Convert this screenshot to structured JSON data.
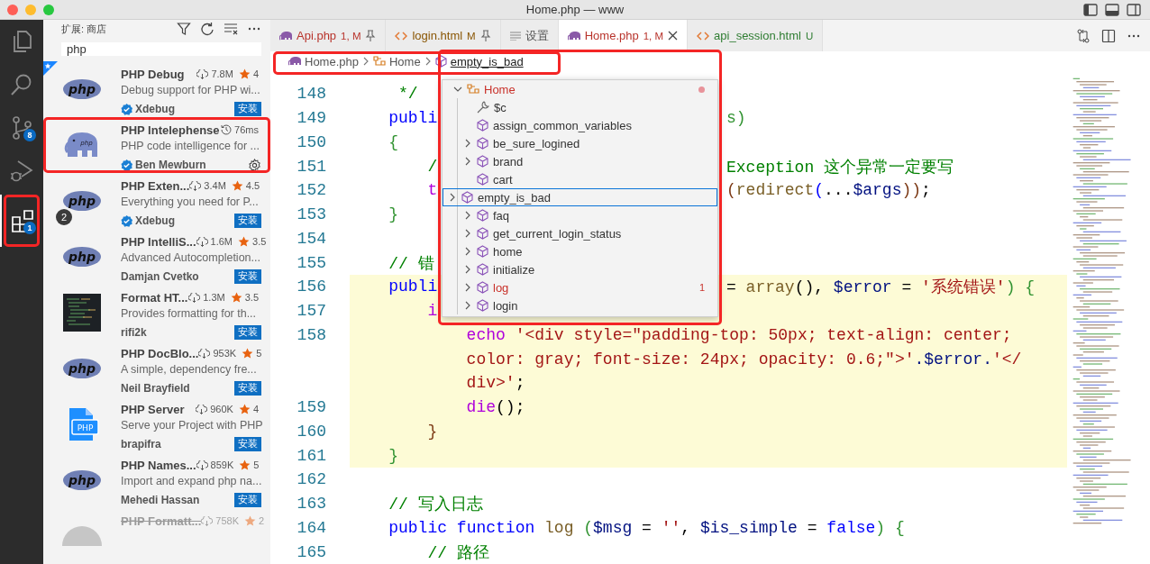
{
  "window": {
    "title": "Home.php — www"
  },
  "activity_bar": [
    {
      "kind": "files",
      "selected": false
    },
    {
      "kind": "search",
      "selected": false
    },
    {
      "kind": "source-control",
      "badge": "8",
      "selected": false
    },
    {
      "kind": "run",
      "selected": false
    },
    {
      "kind": "extensions",
      "badge": "1",
      "selected": true,
      "annotated": true
    }
  ],
  "sidebar": {
    "title": "扩展: 商店",
    "search": {
      "value": "php"
    },
    "extensions": [
      {
        "name": "PHP Debug",
        "description": "Debug support for PHP wi...",
        "author": "Xdebug",
        "verified": true,
        "icon": {
          "kind": "php-logo",
          "text": "php"
        },
        "metric": {
          "kind": "downloads",
          "text": "7.8M"
        },
        "rating": "4",
        "action": "安装",
        "recommended": true
      },
      {
        "name": "PHP Intelephense",
        "description": "PHP code intelligence for ...",
        "author": "Ben Mewburn",
        "verified": true,
        "icon": {
          "kind": "elephant",
          "text": "php"
        },
        "metric": {
          "kind": "time",
          "text": "76ms"
        },
        "annotated": true
      },
      {
        "name": "PHP Exten...",
        "description": "Everything you need for P...",
        "author": "Xdebug",
        "verified": true,
        "icon": {
          "kind": "php-logo",
          "text": "php"
        },
        "metric": {
          "kind": "downloads",
          "text": "3.4M"
        },
        "rating": "4.5",
        "action": "安装",
        "count": "2"
      },
      {
        "name": "PHP IntelliS...",
        "description": "Advanced Autocompletion...",
        "author": "Damjan Cvetko",
        "verified": false,
        "icon": {
          "kind": "php-logo",
          "text": "php"
        },
        "metric": {
          "kind": "downloads",
          "text": "1.6M"
        },
        "rating": "3.5",
        "action": "安装"
      },
      {
        "name": "Format HT...",
        "description": "Provides formatting for th...",
        "author": "rifi2k",
        "verified": false,
        "icon": {
          "kind": "code-thumb"
        },
        "metric": {
          "kind": "downloads",
          "text": "1.3M"
        },
        "rating": "3.5",
        "action": "安装"
      },
      {
        "name": "PHP DocBlo...",
        "description": "A simple, dependency fre...",
        "author": "Neil Brayfield",
        "verified": false,
        "icon": {
          "kind": "php-logo",
          "text": "php"
        },
        "metric": {
          "kind": "downloads",
          "text": "953K"
        },
        "rating": "5",
        "action": "安装"
      },
      {
        "name": "PHP Server",
        "description": "Serve your Project with PHP",
        "author": "brapifra",
        "verified": false,
        "icon": {
          "kind": "php-file",
          "text": "PHP"
        },
        "metric": {
          "kind": "downloads",
          "text": "960K"
        },
        "rating": "4",
        "action": "安装"
      },
      {
        "name": "PHP Names...",
        "description": "Import and expand php na...",
        "author": "Mehedi Hassan",
        "verified": false,
        "icon": {
          "kind": "php-logo",
          "text": "php"
        },
        "metric": {
          "kind": "downloads",
          "text": "859K"
        },
        "rating": "5",
        "action": "安装"
      },
      {
        "name": "PHP Formatt...",
        "icon": {
          "kind": "gray-circle"
        },
        "metric": {
          "kind": "downloads",
          "text": "758K"
        },
        "rating": "2",
        "deprecated": true
      }
    ]
  },
  "tabs": [
    {
      "label": "Api.php",
      "kind": "php",
      "badge": "1, M",
      "color": "#b8332b",
      "pinned": true,
      "selected": false
    },
    {
      "label": "login.html",
      "kind": "html",
      "badge": "M",
      "color": "#895503",
      "pinned": true,
      "selected": false
    },
    {
      "label": "设置",
      "kind": "settings",
      "color": "#555555",
      "selected": false
    },
    {
      "label": "Home.php",
      "kind": "php",
      "badge": "1, M",
      "color": "#b8332b",
      "selected": true
    },
    {
      "label": "api_session.html",
      "kind": "html",
      "badge": "U",
      "color": "#2f7d32",
      "selected": false
    }
  ],
  "breadcrumbs": {
    "annotated": true,
    "items": [
      {
        "label": "Home.php",
        "kind": "file",
        "current": false
      },
      {
        "label": "Home",
        "kind": "class",
        "current": false
      },
      {
        "label": "empty_is_bad",
        "kind": "method",
        "current": true
      }
    ]
  },
  "outline": {
    "annotated": true,
    "header": {
      "label": "Home",
      "expanded": true,
      "error": true,
      "dot": true
    },
    "items": [
      {
        "label": "$c",
        "kind": "property",
        "expandable": false,
        "selected": false,
        "error": false
      },
      {
        "label": "assign_common_variables",
        "kind": "method",
        "expandable": false,
        "selected": false,
        "error": false
      },
      {
        "label": "be_sure_logined",
        "kind": "method",
        "expandable": true,
        "selected": false,
        "error": false
      },
      {
        "label": "brand",
        "kind": "method",
        "expandable": true,
        "selected": false,
        "error": false
      },
      {
        "label": "cart",
        "kind": "method",
        "expandable": false,
        "selected": false,
        "error": false
      },
      {
        "label": "empty_is_bad",
        "kind": "method",
        "expandable": true,
        "selected": true,
        "error": false
      },
      {
        "label": "faq",
        "kind": "method",
        "expandable": true,
        "selected": false,
        "error": false
      },
      {
        "label": "get_current_login_status",
        "kind": "method",
        "expandable": true,
        "selected": false,
        "error": false
      },
      {
        "label": "home",
        "kind": "method",
        "expandable": true,
        "selected": false,
        "error": false
      },
      {
        "label": "initialize",
        "kind": "method",
        "expandable": true,
        "selected": false,
        "error": false
      },
      {
        "label": "log",
        "kind": "method",
        "expandable": true,
        "selected": false,
        "error": true,
        "problems": "1"
      },
      {
        "label": "login",
        "kind": "method",
        "expandable": true,
        "selected": false,
        "error": false
      }
    ]
  },
  "code": [
    {
      "number": "148",
      "highlighted": false,
      "rows": [
        {
          "left": [
            {
              "text": "     */",
              "color": "#008000"
            }
          ]
        }
      ]
    },
    {
      "number": "149",
      "highlighted": false,
      "rows": [
        {
          "left": [
            {
              "text": "    publi",
              "color": "#0000ff"
            }
          ],
          "right": [
            {
              "text": "s)",
              "color": "#319331"
            }
          ]
        }
      ]
    },
    {
      "number": "150",
      "highlighted": false,
      "rows": [
        {
          "left": [
            {
              "text": "    {",
              "color": "#319331"
            }
          ]
        }
      ]
    },
    {
      "number": "151",
      "highlighted": false,
      "rows": [
        {
          "left": [
            {
              "text": "        /",
              "color": "#008000"
            }
          ],
          "right": [
            {
              "text": "Exception 这个异常一定要写",
              "color": "#008000"
            }
          ]
        }
      ]
    },
    {
      "number": "152",
      "highlighted": false,
      "rows": [
        {
          "left": [
            {
              "text": "        t",
              "color": "#af00db"
            }
          ],
          "right": [
            {
              "text": "(",
              "color": "#7b3814"
            },
            {
              "text": "redirect",
              "color": "#795e26"
            },
            {
              "text": "(",
              "color": "#0000ff"
            },
            {
              "text": "...",
              "color": "#000000"
            },
            {
              "text": "$args",
              "color": "#001080"
            },
            {
              "text": "))",
              "color": "#7b3814"
            },
            {
              "text": ";",
              "color": "#000000"
            }
          ]
        }
      ]
    },
    {
      "number": "153",
      "highlighted": false,
      "rows": [
        {
          "left": [
            {
              "text": "    }",
              "color": "#319331"
            }
          ]
        }
      ]
    },
    {
      "number": "154",
      "highlighted": false,
      "rows": [
        {
          "left": []
        }
      ]
    },
    {
      "number": "155",
      "highlighted": false,
      "rows": [
        {
          "left": [
            {
              "text": "    // 错",
              "color": "#008000"
            }
          ]
        }
      ]
    },
    {
      "number": "156",
      "highlighted": true,
      "rows": [
        {
          "left": [
            {
              "text": "    publi",
              "color": "#0000ff"
            }
          ],
          "right": [
            {
              "text": "= ",
              "color": "#000000"
            },
            {
              "text": "array",
              "color": "#795e26"
            },
            {
              "text": "(), ",
              "color": "#000000"
            },
            {
              "text": "$error",
              "color": "#001080"
            },
            {
              "text": " = ",
              "color": "#000000"
            },
            {
              "text": "'系统错误'",
              "color": "#a31515"
            },
            {
              "text": ") {",
              "color": "#319331"
            }
          ]
        }
      ]
    },
    {
      "number": "157",
      "highlighted": true,
      "rows": [
        {
          "left": [
            {
              "text": "        i",
              "color": "#af00db"
            }
          ]
        }
      ]
    },
    {
      "number": "158",
      "highlighted": true,
      "rows": [
        {
          "left": [
            {
              "text": "            echo ",
              "color": "#af00db"
            },
            {
              "text": "'<div style=\"padding-top: 50px; text-align: center;",
              "color": "#a31515"
            }
          ]
        },
        {
          "left": [
            {
              "text": "            color: gray; font-size: 24px; opacity: 0.6;\">'",
              "color": "#a31515"
            },
            {
              "text": ".$error.",
              "color": "#001080"
            },
            {
              "text": "'</",
              "color": "#a31515"
            }
          ]
        },
        {
          "left": [
            {
              "text": "            div>'",
              "color": "#a31515"
            },
            {
              "text": ";",
              "color": "#000000"
            }
          ]
        }
      ]
    },
    {
      "number": "159",
      "highlighted": true,
      "rows": [
        {
          "left": [
            {
              "text": "            die",
              "color": "#af00db"
            },
            {
              "text": "();",
              "color": "#000000"
            }
          ]
        }
      ]
    },
    {
      "number": "160",
      "highlighted": true,
      "rows": [
        {
          "left": [
            {
              "text": "        }",
              "color": "#7b3814"
            }
          ]
        }
      ]
    },
    {
      "number": "161",
      "highlighted": true,
      "rows": [
        {
          "left": [
            {
              "text": "    }",
              "color": "#319331"
            }
          ]
        }
      ]
    },
    {
      "number": "162",
      "highlighted": false,
      "rows": [
        {
          "left": []
        }
      ]
    },
    {
      "number": "163",
      "highlighted": false,
      "rows": [
        {
          "left": [
            {
              "text": "    // 写入日志",
              "color": "#008000"
            }
          ]
        }
      ]
    },
    {
      "number": "164",
      "highlighted": false,
      "rows": [
        {
          "left": [
            {
              "text": "    public ",
              "color": "#0000ff"
            },
            {
              "text": "function ",
              "color": "#0000ff"
            },
            {
              "text": "log",
              "color": "#795e26"
            },
            {
              "text": " (",
              "color": "#319331"
            },
            {
              "text": "$msg",
              "color": "#001080"
            },
            {
              "text": " = ",
              "color": "#000000"
            },
            {
              "text": "''",
              "color": "#a31515"
            },
            {
              "text": ", ",
              "color": "#000000"
            },
            {
              "text": "$is_simple",
              "color": "#001080"
            },
            {
              "text": " = ",
              "color": "#000000"
            },
            {
              "text": "false",
              "color": "#0000ff"
            },
            {
              "text": ") {",
              "color": "#319331"
            }
          ]
        }
      ]
    },
    {
      "number": "165",
      "highlighted": false,
      "rows": [
        {
          "left": [
            {
              "text": "        // 路径",
              "color": "#008000"
            }
          ]
        }
      ]
    }
  ]
}
